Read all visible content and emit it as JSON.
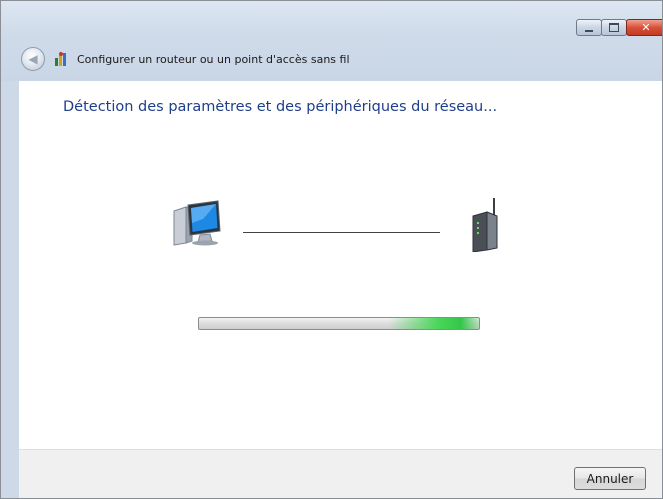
{
  "window": {
    "title": "Configurer un routeur ou un point d'accès sans fil",
    "controls": {
      "minimize_icon": "minimize-icon",
      "maximize_icon": "maximize-icon",
      "close_icon": "close-icon",
      "close_glyph": "✕"
    },
    "back_glyph": "◀"
  },
  "content": {
    "heading": "Détection des paramètres et des périphériques du réseau..."
  },
  "illustration": {
    "computer_icon": "computer-icon",
    "router_icon": "wireless-router-icon"
  },
  "progress": {
    "indeterminate": true,
    "highlight_start": 0.68,
    "highlight_end": 1.0
  },
  "footer": {
    "cancel_label": "Annuler"
  },
  "colors": {
    "heading": "#1f3e8c",
    "titlebar": "#cdd9e7",
    "progress_highlight": "#49d659"
  }
}
